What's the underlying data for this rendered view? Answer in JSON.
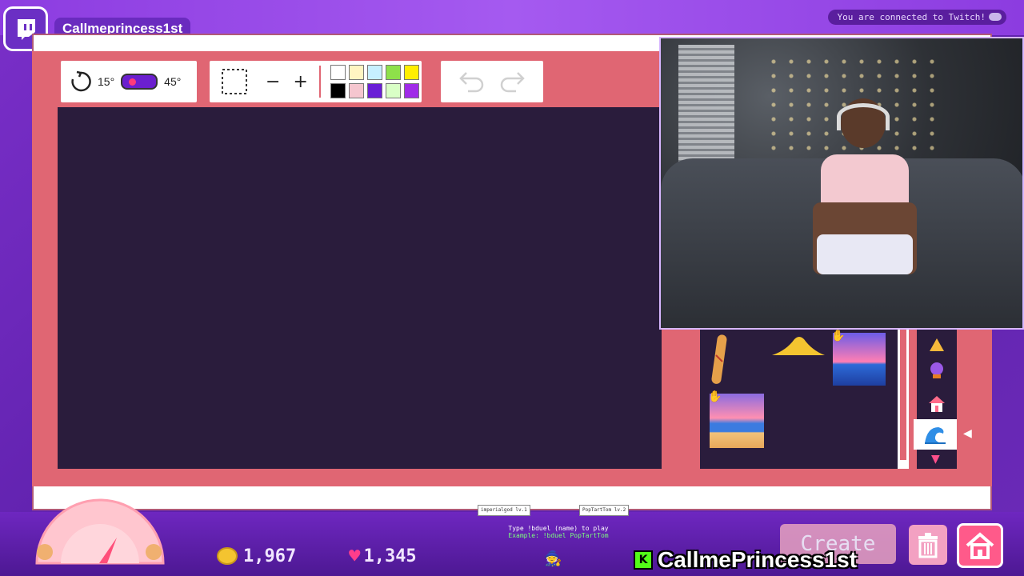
{
  "header": {
    "channel_name": "Callmeprincess1st",
    "status_text": "You are connected to Twitch!"
  },
  "toolbar": {
    "angle_min": "15°",
    "angle_max": "45°",
    "minus_label": "−",
    "plus_label": "+",
    "swatch_colors": [
      "#ffffff",
      "#fff5c2",
      "#c7f0ff",
      "#8ee04a",
      "#ffee00",
      "#000000",
      "#f5c6cf",
      "#6a1fd6",
      "#d9ffc6",
      "#a02be8"
    ]
  },
  "assets": {
    "items": [
      "baguette-item",
      "sand-pile-item",
      "sunset-ocean-item",
      "beach-sunset-item"
    ]
  },
  "categories": {
    "items": [
      "cheese-category",
      "orb-category",
      "house-category",
      "wave-category"
    ],
    "selected": "wave-category"
  },
  "hud": {
    "coins": "1,967",
    "hearts": "1,345",
    "chat_hint_line1": "Type !bduel (name) to play",
    "chat_hint_line2": "Example: !bduel PopTartTom",
    "tag_left": "imperialgod lv.1",
    "tag_right": "PopTartTom lv.2",
    "kick_name": "CallmePrincess1st",
    "create_label": "Create"
  },
  "colors": {
    "frame": "#e06673",
    "canvas": "#2a1c3c",
    "accent": "#7a2fc9"
  }
}
